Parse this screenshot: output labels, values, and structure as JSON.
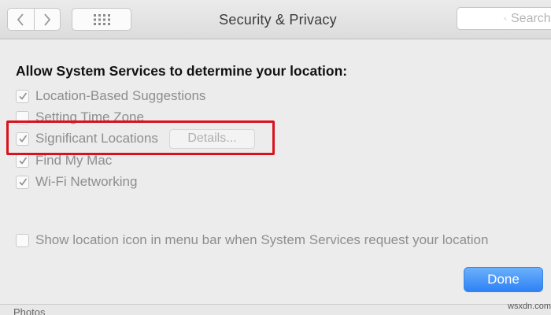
{
  "window": {
    "title": "Security & Privacy"
  },
  "toolbar": {
    "search_placeholder": "Search"
  },
  "location_services": {
    "heading": "Allow System Services to determine your location:",
    "options": [
      {
        "label": "Location-Based Suggestions",
        "checked": true
      },
      {
        "label": "Setting Time Zone",
        "checked": false
      },
      {
        "label": "Significant Locations",
        "checked": true,
        "details_label": "Details..."
      },
      {
        "label": "Find My Mac",
        "checked": true
      },
      {
        "label": "Wi-Fi Networking",
        "checked": true
      }
    ],
    "menu_bar_option": {
      "label": "Show location icon in menu bar when System Services request your location",
      "checked": false
    }
  },
  "footer": {
    "done_label": "Done",
    "partial_text": "Photos"
  },
  "watermark": "wsxdn.com",
  "colors": {
    "highlight": "#d9131d",
    "primary_button": "#2f82f5",
    "disabled_text": "#8e8e8e"
  }
}
